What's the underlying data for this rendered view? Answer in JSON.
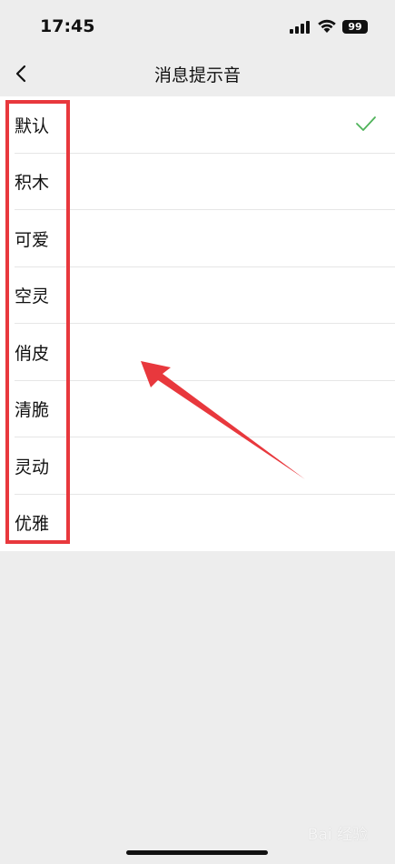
{
  "status_bar": {
    "time": "17:45",
    "battery": "99",
    "icons": [
      "signal-icon",
      "wifi-icon",
      "battery-icon"
    ]
  },
  "nav": {
    "title": "消息提示音",
    "back_icon": "chevron-left-icon"
  },
  "sounds": {
    "selected": "默认",
    "items": [
      {
        "label": "默认",
        "selected": true
      },
      {
        "label": "积木",
        "selected": false
      },
      {
        "label": "可爱",
        "selected": false
      },
      {
        "label": "空灵",
        "selected": false
      },
      {
        "label": "俏皮",
        "selected": false
      },
      {
        "label": "清脆",
        "selected": false
      },
      {
        "label": "灵动",
        "selected": false
      },
      {
        "label": "优雅",
        "selected": false
      }
    ]
  },
  "annotation": {
    "highlight_color": "#e8383d",
    "arrow_color": "#e8383d"
  },
  "colors": {
    "check": "#4fb35a",
    "background": "#ededed",
    "list_background": "#ffffff"
  },
  "watermark": "Bai 经验"
}
